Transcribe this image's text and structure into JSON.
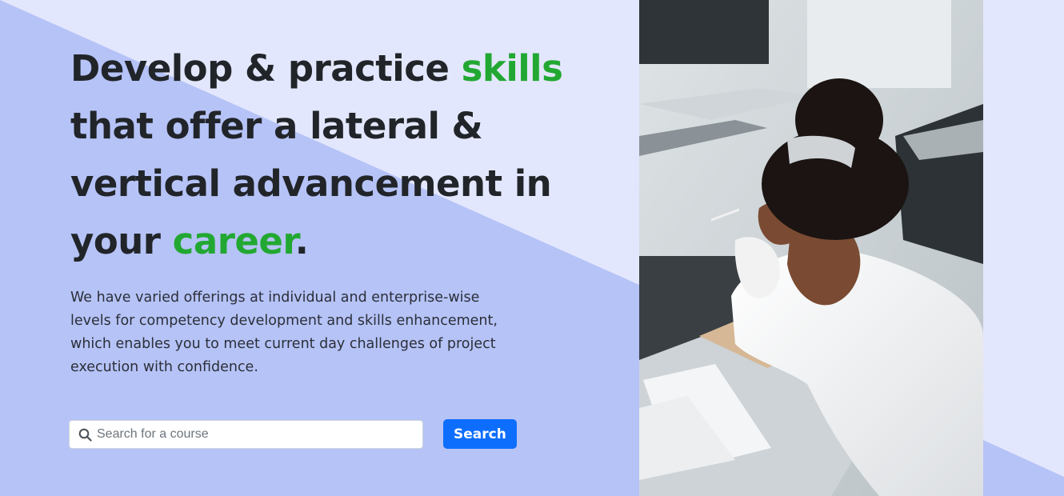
{
  "colors": {
    "background_light": "#e3e7fd",
    "background_diagonal": "#b6c3f7",
    "heading_text": "#212529",
    "accent_green": "#22a832",
    "button_blue": "#0d6efd"
  },
  "hero": {
    "headline": {
      "part1": "Develop & practice ",
      "accent1": "skills",
      "part2": " that offer a lateral & vertical advancement in your ",
      "accent2": "career",
      "end": "."
    },
    "description": "We have varied offerings at individual and enterprise-wise levels for competency development and skills enhancement, which enables you to meet current day challenges of project execution with confidence."
  },
  "search": {
    "icon": "search-icon",
    "placeholder": "Search for a course",
    "value": "",
    "button_label": "Search"
  },
  "image": {
    "subject": "student-studying-photo"
  }
}
